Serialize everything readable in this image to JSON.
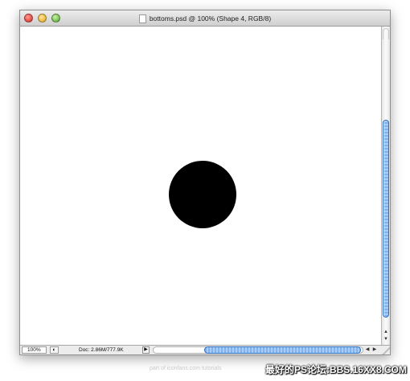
{
  "window": {
    "title": "bottoms.psd @ 100% (Shape 4, RGB/8)"
  },
  "canvas": {
    "shape": "filled-circle",
    "fill_color": "#000000",
    "background_color": "#ffffff"
  },
  "statusbar": {
    "zoom": "100%",
    "doc_size": "Doc: 2.86M/777.9K",
    "menu_arrow": "▶"
  },
  "scrollbars": {
    "accent_color": "#7fb3ee",
    "arrow_up": "▲",
    "arrow_down": "▼",
    "arrow_left": "◀",
    "arrow_right": "▶"
  },
  "caption": "part of iconfans.com tutorials",
  "watermark": "最好的PS论坛:BBS.16XX8.COM"
}
